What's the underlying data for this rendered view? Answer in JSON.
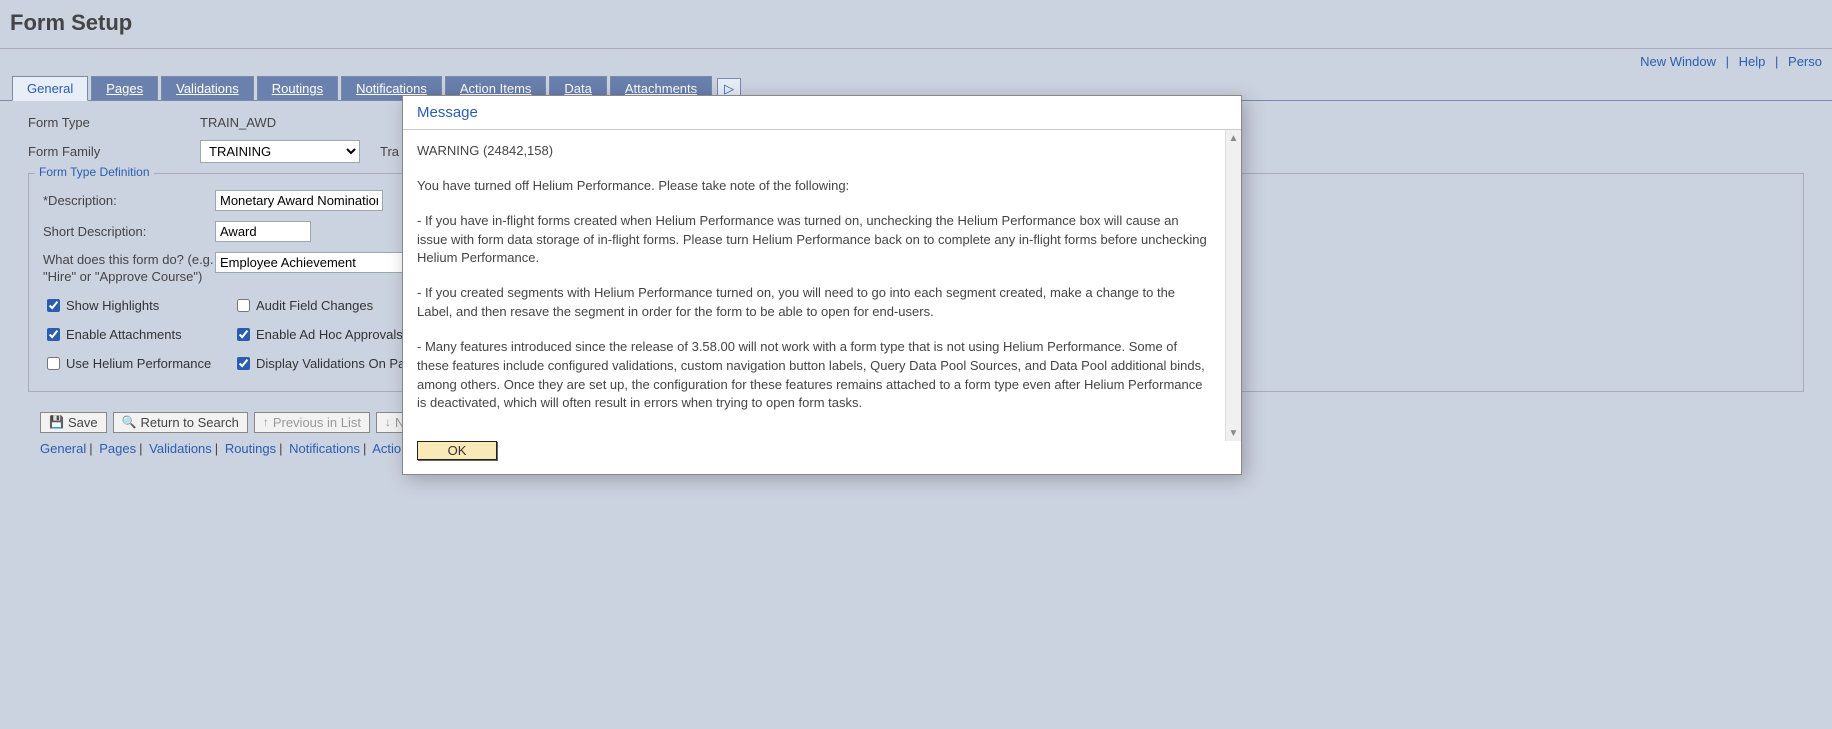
{
  "page_title": "Form Setup",
  "top_links": {
    "new_window": "New Window",
    "help": "Help",
    "personalize": "Perso"
  },
  "tabs": [
    {
      "label": "General",
      "active": true
    },
    {
      "label": "Pages"
    },
    {
      "label": "Validations"
    },
    {
      "label": "Routings"
    },
    {
      "label": "Notifications"
    },
    {
      "label": "Action Items"
    },
    {
      "label": "Data"
    },
    {
      "label": "Attachments"
    }
  ],
  "fields": {
    "form_type_label": "Form Type",
    "form_type_value": "TRAIN_AWD",
    "form_family_label": "Form Family",
    "form_family_value": "TRAINING",
    "form_family_extra": "Tra"
  },
  "section": {
    "title": "Form Type Definition",
    "description_label": "*Description:",
    "description_value": "Monetary Award Nomination",
    "short_label": "Short Description:",
    "short_value": "Award",
    "purpose_label": "What does this form do? (e.g. \"Hire\" or \"Approve Course\")",
    "purpose_value": "Employee Achievement"
  },
  "checkboxes": {
    "show_highlights": "Show Highlights",
    "audit_field_changes": "Audit Field Changes",
    "enable_attachments": "Enable Attachments",
    "enable_adhoc": "Enable Ad Hoc Approvals",
    "use_helium": "Use Helium Performance",
    "display_validations": "Display Validations On Page"
  },
  "bottom_bar": {
    "save": "Save",
    "return_search": "Return to Search",
    "previous": "Previous in List",
    "next": "N"
  },
  "bottom_links": [
    "General",
    "Pages",
    "Validations",
    "Routings",
    "Notifications",
    "Action Items"
  ],
  "modal": {
    "title": "Message",
    "warning_header": "WARNING (24842,158)",
    "intro": "You have turned off Helium Performance. Please take note of the following:",
    "p1": "- If you have in-flight forms created when Helium Performance was turned on, unchecking the Helium Performance box will cause an issue with form data storage of in-flight forms. Please turn Helium Performance back on to complete any in-flight forms before unchecking Helium Performance.",
    "p2": "- If you created segments with Helium Performance turned on, you will need to go into each segment created, make a change to the Label, and then resave the segment in order for the form to be able to open for end-users.",
    "p3": "- Many features introduced since the release of 3.58.00 will not work with a form type that is not using Helium Performance. Some of these features include configured validations, custom navigation button labels, Query Data Pool Sources, and Data Pool additional binds, among others. Once they are set up, the configuration for these features remains attached to a form type even after Helium Performance is deactivated, which will often result in errors when trying to open form tasks.",
    "ok": "OK"
  }
}
